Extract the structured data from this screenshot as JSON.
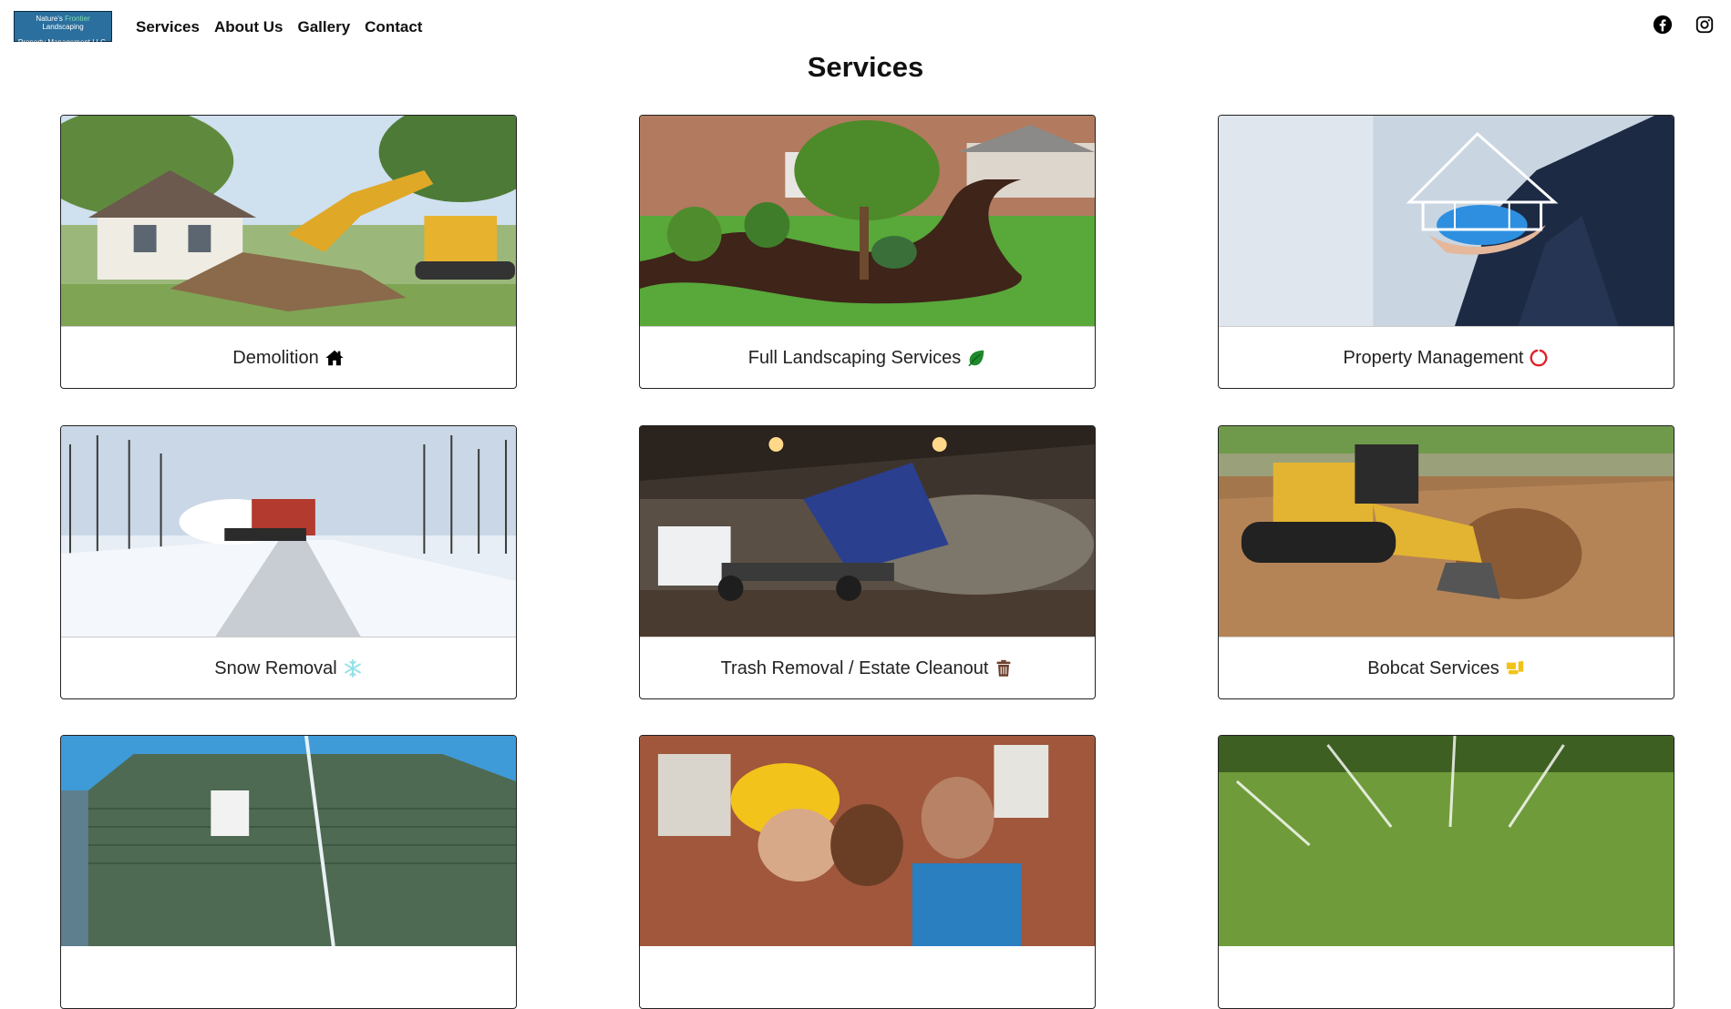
{
  "nav": {
    "logo": {
      "line1_a": "Nature's",
      "line1_b": "Frontier",
      "line1_c": "Landscaping",
      "line2": "Property Management LLC."
    },
    "links": [
      "Services",
      "About Us",
      "Gallery",
      "Contact"
    ],
    "social": [
      "facebook-icon",
      "instagram-icon"
    ]
  },
  "page": {
    "title": "Services"
  },
  "services": [
    {
      "label": "Demolition",
      "icon": "house-icon",
      "icon_color": "#000000"
    },
    {
      "label": "Full Landscaping Services",
      "icon": "leaf-icon",
      "icon_color": "#1f8a2c"
    },
    {
      "label": "Property Management",
      "icon": "circle-notch-icon",
      "icon_color": "#e0202a"
    },
    {
      "label": "Snow Removal",
      "icon": "snowflake-icon",
      "icon_color": "#8fe0e8"
    },
    {
      "label": "Trash Removal / Estate Cleanout",
      "icon": "trash-icon",
      "icon_color": "#6b3d2b"
    },
    {
      "label": "Bobcat Services",
      "icon": "bulldozer-icon",
      "icon_color": "#f2c21a"
    }
  ]
}
